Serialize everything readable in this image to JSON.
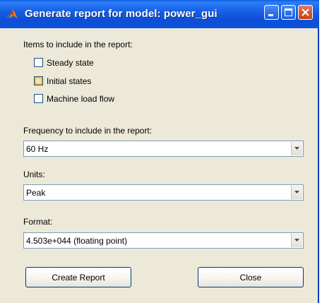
{
  "window": {
    "title": "Generate report for model: power_gui",
    "accent_color": "#0c4fd6",
    "close_color": "#d7532f"
  },
  "items": {
    "label": "Items to include in the report:",
    "options": [
      {
        "label": "Steady state",
        "checked": false
      },
      {
        "label": "Initial states",
        "checked": false
      },
      {
        "label": "Machine load flow",
        "checked": false
      }
    ]
  },
  "frequency": {
    "label": "Frequency to include in the report:",
    "value": "60 Hz"
  },
  "units": {
    "label": "Units:",
    "value": "Peak"
  },
  "format": {
    "label": "Format:",
    "value": "4.503e+044 (floating point)"
  },
  "buttons": {
    "create_label": "Create Report",
    "close_label": "Close"
  },
  "icons": {
    "app": "matlab-logo-icon",
    "minimize": "minimize-icon",
    "maximize": "maximize-icon",
    "close": "close-icon",
    "dropdown": "chevron-down-icon"
  }
}
